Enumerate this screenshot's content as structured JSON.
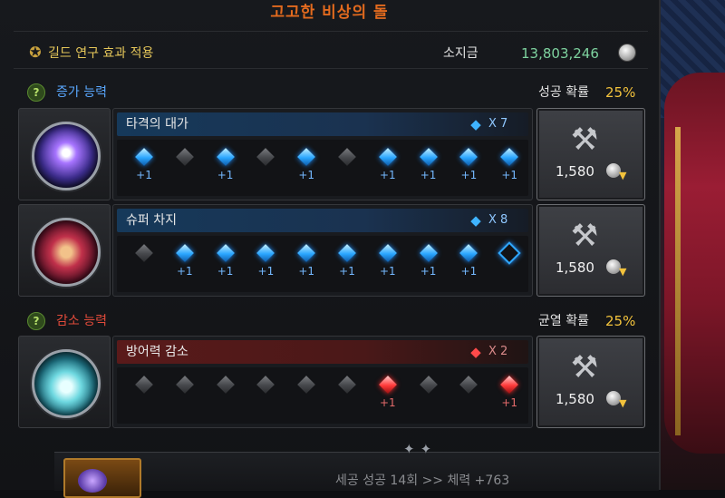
{
  "title": "고고한 비상의 돌",
  "guild": {
    "label": "길드 연구 효과 적용",
    "icon": "guild-emblem-icon"
  },
  "money": {
    "label": "소지금",
    "value": "13,803,246",
    "icon": "silver-coin-icon"
  },
  "increase_section": {
    "title": "증가 능력",
    "title_color": "#5aa8ff",
    "rate_label": "성공 확률",
    "rate_value": "25%"
  },
  "decrease_section": {
    "title": "감소 능력",
    "title_color": "#e04a3a",
    "rate_label": "균열 확률",
    "rate_value": "25%"
  },
  "abilities": [
    {
      "name": "타격의 대가",
      "count": "X 7",
      "color": "blue",
      "icon": "purple-orb-icon",
      "cost": "1,580",
      "slots": [
        {
          "state": "success",
          "plus": "+1"
        },
        {
          "state": "fail",
          "plus": ""
        },
        {
          "state": "success",
          "plus": "+1"
        },
        {
          "state": "fail",
          "plus": ""
        },
        {
          "state": "success",
          "plus": "+1"
        },
        {
          "state": "fail",
          "plus": ""
        },
        {
          "state": "success",
          "plus": "+1"
        },
        {
          "state": "success",
          "plus": "+1"
        },
        {
          "state": "success",
          "plus": "+1"
        },
        {
          "state": "success",
          "plus": "+1"
        }
      ]
    },
    {
      "name": "슈퍼 차지",
      "count": "X 8",
      "color": "blue",
      "icon": "warrior-orb-icon",
      "cost": "1,580",
      "slots": [
        {
          "state": "fail",
          "plus": ""
        },
        {
          "state": "success",
          "plus": "+1"
        },
        {
          "state": "success",
          "plus": "+1"
        },
        {
          "state": "success",
          "plus": "+1"
        },
        {
          "state": "success",
          "plus": "+1"
        },
        {
          "state": "success",
          "plus": "+1"
        },
        {
          "state": "success",
          "plus": "+1"
        },
        {
          "state": "success",
          "plus": "+1"
        },
        {
          "state": "success",
          "plus": "+1"
        },
        {
          "state": "empty",
          "plus": ""
        }
      ]
    },
    {
      "name": "방어력 감소",
      "count": "X 2",
      "color": "red",
      "icon": "ice-shield-orb-icon",
      "cost": "1,580",
      "slots": [
        {
          "state": "fail",
          "plus": ""
        },
        {
          "state": "fail",
          "plus": ""
        },
        {
          "state": "fail",
          "plus": ""
        },
        {
          "state": "fail",
          "plus": ""
        },
        {
          "state": "fail",
          "plus": ""
        },
        {
          "state": "fail",
          "plus": ""
        },
        {
          "state": "success",
          "plus": "+1"
        },
        {
          "state": "fail",
          "plus": ""
        },
        {
          "state": "fail",
          "plus": ""
        },
        {
          "state": "success",
          "plus": "+1"
        }
      ]
    }
  ],
  "bottom": {
    "status_text": "세공 성공 14회 >> 체력 +763"
  }
}
